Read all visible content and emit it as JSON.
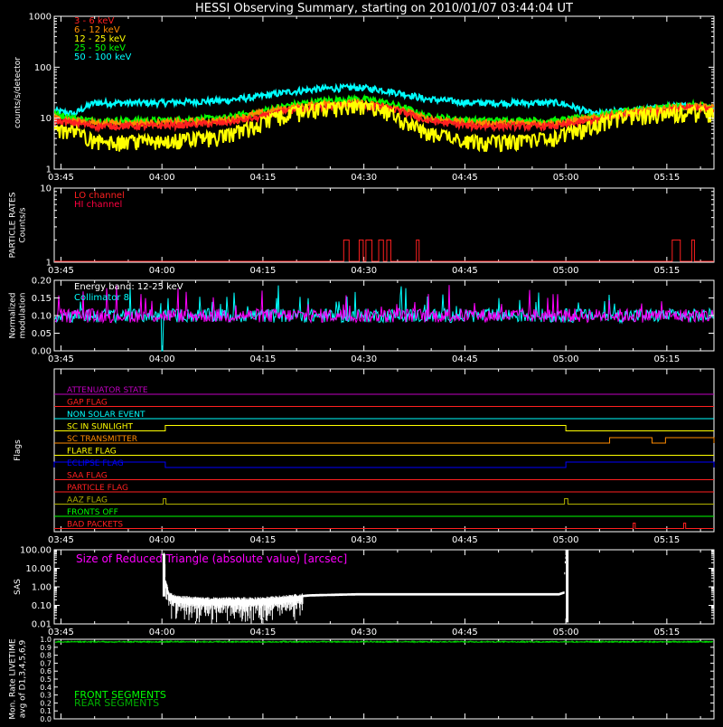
{
  "title": "HESSI Observing Summary, starting on 2010/01/07 03:44:04 UT",
  "colors": {
    "background": "#000000",
    "axis": "#ffffff",
    "red": "#ff2020",
    "orange": "#ff8c00",
    "yellow": "#ffff00",
    "green": "#00ff00",
    "cyan": "#00ffff",
    "magenta": "#ff00ff",
    "blue": "#0000ff",
    "crimson": "#ff0040",
    "olive": "#b0b000",
    "darkgreen": "#00b000",
    "white": "#ffffff",
    "purple": "#c000c0"
  },
  "time_axis": {
    "ticks": [
      "03:45",
      "04:00",
      "04:15",
      "04:30",
      "04:45",
      "05:00",
      "05:15"
    ],
    "start_min": 0,
    "end_min": 98
  },
  "chart_data": [
    {
      "id": "rates",
      "type": "line",
      "ylabel": "counts/s/detector",
      "yscale": "log",
      "ylim": [
        1,
        1000
      ],
      "yticks": [
        "1",
        "10",
        "100",
        "1000"
      ],
      "legend_position": "top-left",
      "series": [
        {
          "name": "3 - 6 keV",
          "color": "#ff2020",
          "x": [
            0,
            3,
            6,
            15,
            25,
            30,
            35,
            40,
            45,
            48,
            52,
            55,
            62,
            65,
            70,
            75,
            80,
            85,
            90,
            95,
            98
          ],
          "y": [
            9,
            8,
            7,
            7,
            8,
            10,
            14,
            17,
            18,
            17,
            13,
            9,
            7,
            7,
            7,
            7,
            9,
            12,
            14,
            16,
            15
          ]
        },
        {
          "name": "6 - 12 keV",
          "color": "#ff8c00",
          "x": [
            0,
            3,
            6,
            15,
            25,
            30,
            35,
            40,
            45,
            48,
            52,
            55,
            62,
            65,
            70,
            75,
            80,
            85,
            90,
            95,
            98
          ],
          "y": [
            10,
            9,
            8,
            8,
            9,
            12,
            16,
            19,
            20,
            18,
            14,
            10,
            8,
            8,
            8,
            8,
            10,
            13,
            15,
            17,
            16
          ]
        },
        {
          "name": "12 - 25 keV",
          "color": "#ffff00",
          "x": [
            0,
            3,
            6,
            15,
            25,
            30,
            35,
            40,
            45,
            48,
            52,
            55,
            62,
            65,
            70,
            75,
            80,
            85,
            90,
            95,
            98
          ],
          "y": [
            7,
            6,
            4,
            4,
            5,
            8,
            14,
            18,
            19,
            17,
            10,
            6,
            4,
            4,
            4,
            5,
            8,
            12,
            14,
            15,
            14
          ]
        },
        {
          "name": "25 - 50 keV",
          "color": "#00ff00",
          "x": [
            0,
            3,
            6,
            15,
            25,
            30,
            35,
            40,
            45,
            48,
            52,
            55,
            62,
            65,
            70,
            75,
            80,
            85,
            90,
            95,
            98
          ],
          "y": [
            12,
            10,
            9,
            9,
            10,
            13,
            18,
            22,
            24,
            22,
            16,
            11,
            9,
            9,
            9,
            9,
            11,
            14,
            16,
            18,
            17
          ]
        },
        {
          "name": "50 - 100 keV",
          "color": "#00ffff",
          "x": [
            0,
            3,
            6,
            15,
            25,
            30,
            35,
            40,
            45,
            48,
            52,
            55,
            62,
            65,
            70,
            75,
            80,
            85,
            90,
            95,
            98
          ],
          "y": [
            14,
            12,
            20,
            20,
            22,
            26,
            33,
            38,
            40,
            37,
            30,
            24,
            20,
            20,
            20,
            20,
            12,
            14,
            16,
            18,
            17
          ]
        }
      ]
    },
    {
      "id": "particle",
      "type": "line",
      "ylabel": "PARTICLE RATES Counts/s",
      "yscale": "log",
      "ylim": [
        1,
        10
      ],
      "yticks": [
        "1",
        "10"
      ],
      "series": [
        {
          "name": "LO channel",
          "color": "#ff2020",
          "x": [
            43.0,
            43.8,
            45.3,
            45.9,
            46.3,
            47.2,
            48.2,
            48.9,
            49.4,
            50.0,
            53.8,
            54.2,
            91.8,
            93.0,
            94.7,
            95.1
          ],
          "y": [
            2,
            2,
            2,
            2,
            2,
            2,
            2,
            2,
            2,
            2,
            2,
            2,
            2,
            2,
            2,
            2
          ]
        },
        {
          "name": "HI channel",
          "color": "#ff0040",
          "x": [],
          "y": []
        }
      ]
    },
    {
      "id": "modulation",
      "type": "line",
      "ylabel": "Normalized modulation",
      "ylim": [
        0.0,
        0.2
      ],
      "yticks": [
        "0.00",
        "0.05",
        "0.10",
        "0.15",
        "0.20"
      ],
      "annotation": "Energy band: 12-25 keV",
      "series": [
        {
          "name": "Collimator 8",
          "color": "#00ffff",
          "mean": 0.1
        },
        {
          "name": "",
          "color": "#ff00ff",
          "mean": 0.1
        }
      ],
      "dip_x": 16
    },
    {
      "id": "flags",
      "type": "line",
      "ylabel": "Flags",
      "flags": [
        {
          "name": "ATTENUATOR STATE",
          "color": "#c000c0",
          "on": []
        },
        {
          "name": "GAP FLAG",
          "color": "#ff2020",
          "on": []
        },
        {
          "name": "NON SOLAR EVENT",
          "color": "#00ffff",
          "on": []
        },
        {
          "name": "SC IN SUNLIGHT",
          "color": "#ffff00",
          "on": [
            [
              16.5,
              76.0
            ]
          ]
        },
        {
          "name": "SC TRANSMITTER",
          "color": "#ff8c00",
          "on": [
            [
              82.5,
              88.8
            ],
            [
              90.8,
              98
            ]
          ]
        },
        {
          "name": "FLARE FLAG",
          "color": "#ffff00",
          "on": []
        },
        {
          "name": "ECLIPSE FLAG",
          "color": "#0000ff",
          "on": [
            [
              0,
              16.5
            ],
            [
              76.0,
              98
            ]
          ]
        },
        {
          "name": "SAA FLAG",
          "color": "#ff2020",
          "on": []
        },
        {
          "name": "PARTICLE FLAG",
          "color": "#ff2020",
          "on": []
        },
        {
          "name": "AAZ FLAG",
          "color": "#b0b000",
          "on": [
            [
              16.2,
              16.6
            ],
            [
              75.8,
              76.3
            ]
          ]
        },
        {
          "name": "FRONTS OFF",
          "color": "#00ff00",
          "on": []
        },
        {
          "name": "BAD PACKETS",
          "color": "#ff2020",
          "on": [
            [
              86.0,
              86.3
            ],
            [
              93.5,
              93.8
            ]
          ]
        }
      ]
    },
    {
      "id": "sas",
      "type": "line",
      "ylabel": "SAS",
      "yscale": "log",
      "ylim": [
        0.01,
        100
      ],
      "yticks": [
        "0.01",
        "0.10",
        "1.00",
        "10.00",
        "100.00"
      ],
      "annotation": "Size of Reduced Triangle (absolute value) [arcsec]",
      "series": [
        {
          "name": "",
          "color": "#ffffff",
          "x": [
            16.3,
            16.5,
            17,
            18,
            22,
            26,
            30,
            34,
            38,
            45,
            55,
            65,
            75,
            75.8,
            76.2
          ],
          "y": [
            60,
            2,
            0.4,
            0.25,
            0.2,
            0.2,
            0.2,
            0.25,
            0.35,
            0.4,
            0.4,
            0.4,
            0.4,
            0.5,
            80
          ]
        }
      ]
    },
    {
      "id": "livetime",
      "type": "line",
      "ylabel": "Mon. Rate LIVETIME avg of D1,3,4,5,6,9",
      "ylim": [
        0.0,
        1.0
      ],
      "yticks": [
        "0.0",
        "0.1",
        "0.2",
        "0.3",
        "0.4",
        "0.5",
        "0.6",
        "0.7",
        "0.8",
        "0.9",
        "1.0"
      ],
      "series": [
        {
          "name": "FRONT SEGMENTS",
          "color": "#00ff00",
          "mean": 0.97
        },
        {
          "name": "REAR SEGMENTS",
          "color": "#00b000",
          "mean": 0.965
        }
      ]
    }
  ]
}
